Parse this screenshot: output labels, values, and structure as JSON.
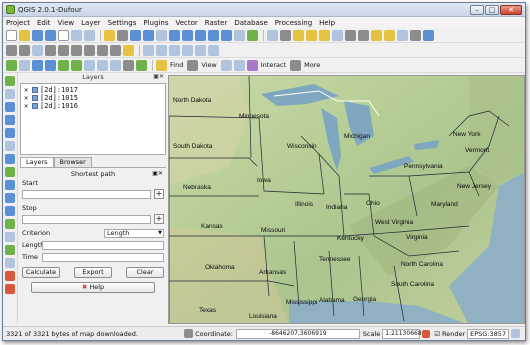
{
  "window": {
    "title": "QGIS 2.0.1-Dufour"
  },
  "menu": [
    "Project",
    "Edit",
    "View",
    "Layer",
    "Settings",
    "Plugins",
    "Vector",
    "Raster",
    "Database",
    "Processing",
    "Help"
  ],
  "toolbar3": {
    "find": "Find",
    "view": "View",
    "interact": "Interact",
    "more": "More"
  },
  "layers_panel": {
    "title": "Layers",
    "items": [
      "[2d]:1017",
      "[2d]:1015",
      "[2d]:1016"
    ]
  },
  "tabs": [
    "Layers",
    "Browser"
  ],
  "shortest_path": {
    "title": "Shortest path",
    "start_label": "Start",
    "stop_label": "Stop",
    "criterion_label": "Criterion",
    "criterion_value": "Length",
    "length_label": "Length",
    "time_label": "Time",
    "calculate": "Calculate",
    "export": "Export",
    "clear": "Clear",
    "help": "Help"
  },
  "map_labels": [
    "North Dakota",
    "Minnesota",
    "South Dakota",
    "Wisconsin",
    "Michigan",
    "Iowa",
    "Nebraska",
    "Illinois",
    "Indiana",
    "Ohio",
    "Pennsylvania",
    "New York",
    "Vermont",
    "Kansas",
    "Missouri",
    "Kentucky",
    "West Virginia",
    "Virginia",
    "Maryland",
    "New Jersey",
    "Oklahoma",
    "Tennessee",
    "North Carolina",
    "Arkansas",
    "South Carolina",
    "Texas",
    "Mississippi",
    "Alabama",
    "Georgia",
    "Louisiana"
  ],
  "status": {
    "message": "3321 of 3321 bytes of map downloaded.",
    "coordinate_label": "Coordinate:",
    "coordinate_value": "-8646207,3606919",
    "scale_label": "Scale",
    "scale_value": "1:21130668",
    "render_label": "Render",
    "epsg": "EPSG:3857"
  }
}
